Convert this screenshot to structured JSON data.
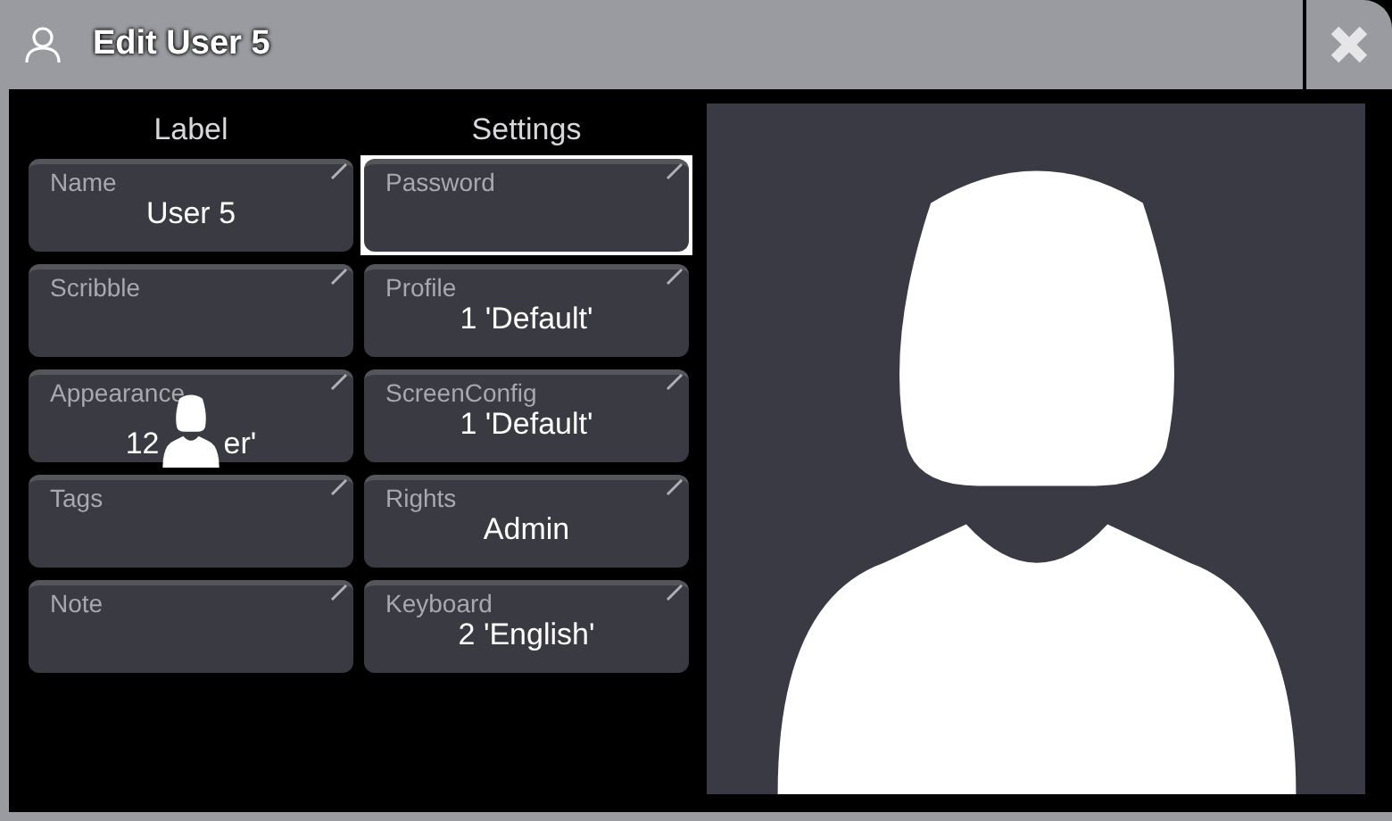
{
  "window": {
    "title": "Edit User 5"
  },
  "columns": [
    {
      "heading": "Label",
      "cells": [
        {
          "label": "Name",
          "value": "User 5",
          "selected": false
        },
        {
          "label": "Scribble",
          "selected": false
        },
        {
          "label": "Appearance",
          "value_start": "12",
          "value_end": "er'",
          "selected": false
        },
        {
          "label": "Tags",
          "selected": false
        },
        {
          "label": "Note",
          "selected": false
        }
      ]
    },
    {
      "heading": "Settings",
      "cells": [
        {
          "label": "Password",
          "selected": true
        },
        {
          "label": "Profile",
          "value": "1 'Default'",
          "selected": false
        },
        {
          "label": "ScreenConfig",
          "value": "1 'Default'",
          "selected": false
        },
        {
          "label": "Rights",
          "value": "Admin",
          "selected": false
        },
        {
          "label": "Keyboard",
          "value": "2 'English'",
          "selected": false
        }
      ]
    }
  ]
}
